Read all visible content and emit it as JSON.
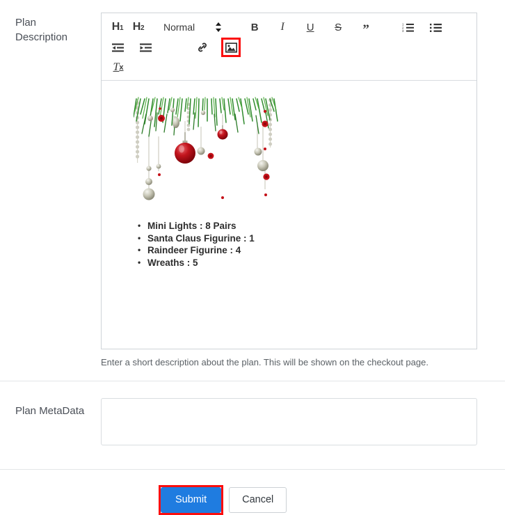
{
  "form": {
    "description_label": "Plan\nDescription",
    "description_label_line1": "Plan",
    "description_label_line2": "Description",
    "description_help": "Enter a short description about the plan. This will be shown on the checkout page.",
    "metadata_label": "Plan MetaData",
    "metadata_value": "",
    "metadata_placeholder": ""
  },
  "toolbar": {
    "h1_label": "H",
    "h1_sub": "1",
    "h2_label": "H",
    "h2_sub": "2",
    "format_select_value": "Normal",
    "stepper_up": "▲",
    "stepper_down": "▼",
    "bold_label": "B",
    "italic_label": "I",
    "underline_label": "U",
    "strike_label": "S",
    "blockquote_label": "”",
    "ordered_list_icon": "ordered-list-icon",
    "bullet_list_icon": "bullet-list-icon",
    "outdent_icon": "outdent-icon",
    "indent_icon": "indent-icon",
    "link_icon": "link-icon",
    "image_icon": "image-icon",
    "clear_format_label": "T",
    "clear_format_sub": "x",
    "highlight_color": "#fb0e0e"
  },
  "editor": {
    "image_alt": "christmas-garland-decoration",
    "list_items": [
      "Mini Lights : 8 Pairs",
      "Santa Claus Figurine : 1",
      "Raindeer Figurine : 4",
      "Wreaths : 5"
    ]
  },
  "footer": {
    "submit_label": "Submit",
    "cancel_label": "Cancel",
    "submit_color": "#1f7ce0",
    "highlight_color": "#fb0e0e"
  }
}
